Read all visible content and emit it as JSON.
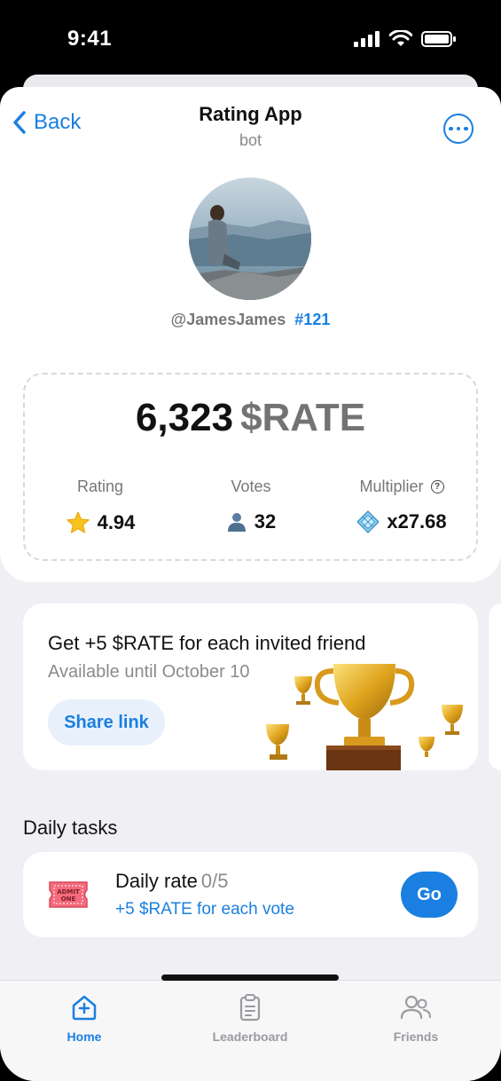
{
  "status_bar": {
    "time": "9:41"
  },
  "header": {
    "back_label": "Back",
    "title": "Rating App",
    "subtitle": "bot"
  },
  "profile": {
    "username": "@JamesJames",
    "rank": "#121"
  },
  "balance": {
    "amount": "6,323",
    "currency": "$RATE"
  },
  "stats": [
    {
      "label": "Rating",
      "value": "4.94",
      "icon": "star-icon"
    },
    {
      "label": "Votes",
      "value": "32",
      "icon": "person-icon"
    },
    {
      "label": "Multiplier",
      "value": "x27.68",
      "icon": "diamond-icon"
    }
  ],
  "invite": {
    "title": "Get +5 $RATE for each invited friend",
    "subtitle": "Available until October 10",
    "button_label": "Share link"
  },
  "daily_tasks": {
    "section_title": "Daily tasks",
    "task_title": "Daily rate",
    "task_count": "0/5",
    "task_sub": "+5 $RATE for each vote",
    "button_label": "Go",
    "ticket_text_1": "ADMIT",
    "ticket_text_2": "ONE"
  },
  "tabs": [
    {
      "label": "Home",
      "icon": "home-plus-icon",
      "active": true
    },
    {
      "label": "Leaderboard",
      "icon": "clipboard-icon",
      "active": false
    },
    {
      "label": "Friends",
      "icon": "friends-icon",
      "active": false
    }
  ],
  "colors": {
    "accent": "#1a7fe0",
    "background": "#efeff4",
    "card": "#ffffff"
  }
}
